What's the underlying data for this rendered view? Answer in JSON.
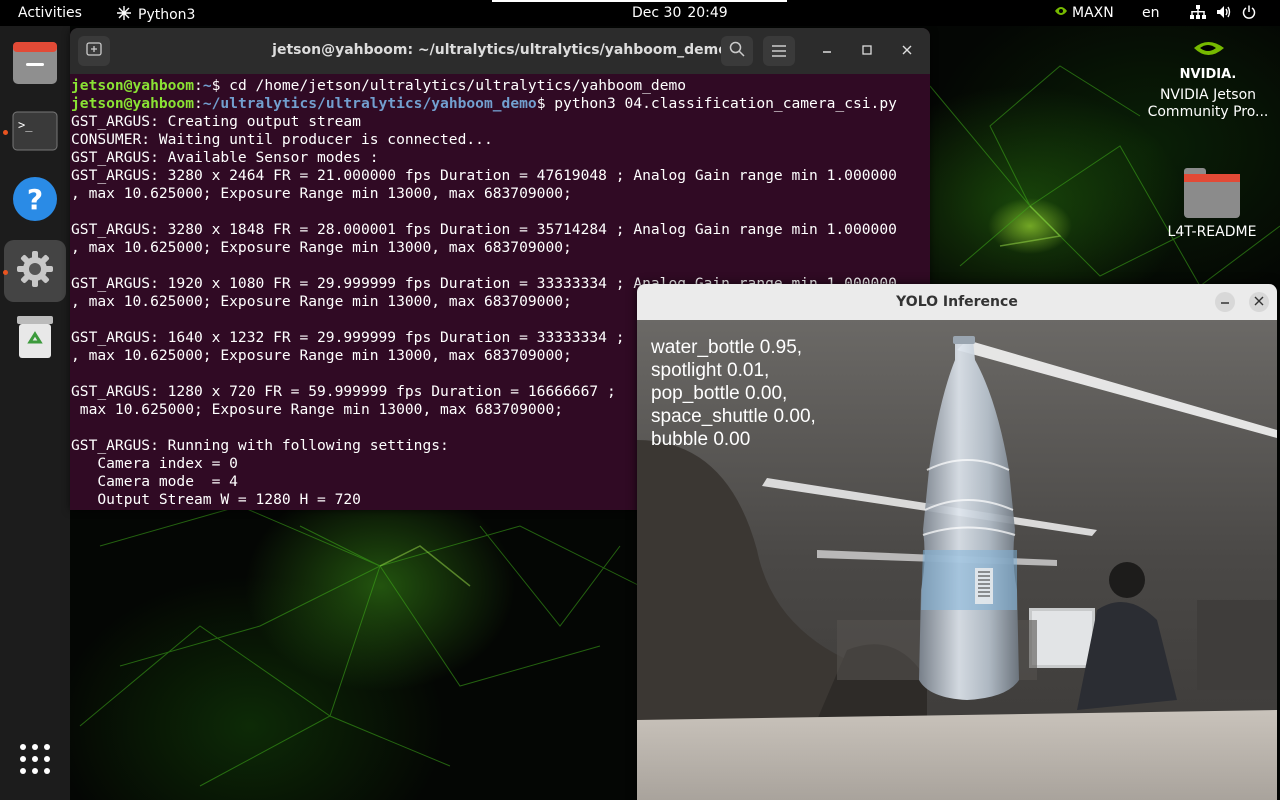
{
  "topbar": {
    "activities": "Activities",
    "app_name": "Python3",
    "date": "Dec 30",
    "time": "20:49",
    "power_mode": "MAXN",
    "language": "en"
  },
  "dock": {
    "items": [
      "files",
      "terminal",
      "help",
      "settings",
      "trash",
      "show-apps"
    ]
  },
  "desktop": {
    "nvidia_label": "NVIDIA Jetson Community Pro...",
    "readme_label": "L4T-README"
  },
  "terminal": {
    "title": "jetson@yahboom: ~/ultralytics/ultralytics/yahboom_demo",
    "prompt1_user": "jetson@yahboom",
    "prompt1_path": "~",
    "prompt1_cmd": "$ cd /home/jetson/ultralytics/ultralytics/yahboom_demo",
    "prompt2_user": "jetson@yahboom",
    "prompt2_path": "~/ultralytics/ultralytics/yahboom_demo",
    "prompt2_cmd": "$ python3 04.classification_camera_csi.py",
    "lines": [
      "GST_ARGUS: Creating output stream",
      "CONSUMER: Waiting until producer is connected...",
      "GST_ARGUS: Available Sensor modes :",
      "GST_ARGUS: 3280 x 2464 FR = 21.000000 fps Duration = 47619048 ; Analog Gain range min 1.000000",
      ", max 10.625000; Exposure Range min 13000, max 683709000;",
      "",
      "GST_ARGUS: 3280 x 1848 FR = 28.000001 fps Duration = 35714284 ; Analog Gain range min 1.000000",
      ", max 10.625000; Exposure Range min 13000, max 683709000;",
      "",
      "GST_ARGUS: 1920 x 1080 FR = 29.999999 fps Duration = 33333334 ; Analog Gain range min 1.000000",
      ", max 10.625000; Exposure Range min 13000, max 683709000;",
      "",
      "GST_ARGUS: 1640 x 1232 FR = 29.999999 fps Duration = 33333334 ;",
      ", max 10.625000; Exposure Range min 13000, max 683709000;",
      "",
      "GST_ARGUS: 1280 x 720 FR = 59.999999 fps Duration = 16666667 ;",
      " max 10.625000; Exposure Range min 13000, max 683709000;",
      "",
      "GST_ARGUS: Running with following settings:",
      "   Camera index = 0",
      "   Camera mode  = 4",
      "   Output Stream W = 1280 H = 720"
    ]
  },
  "yolo": {
    "title": "YOLO Inference",
    "labels": [
      "water_bottle 0.95,",
      "spotlight 0.01,",
      "pop_bottle 0.00,",
      "space_shuttle 0.00,",
      "bubble 0.00"
    ]
  }
}
